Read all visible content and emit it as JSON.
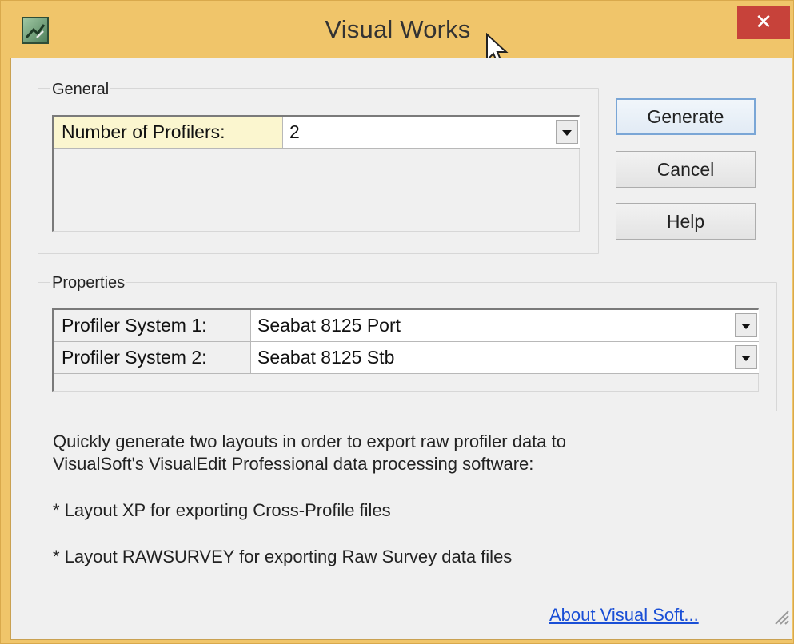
{
  "window": {
    "title": "Visual Works",
    "close_label": "✕"
  },
  "general": {
    "label": "General",
    "rows": [
      {
        "label": "Number of Profilers:",
        "value": "2"
      }
    ]
  },
  "properties": {
    "label": "Properties",
    "rows": [
      {
        "label": "Profiler System 1:",
        "value": "Seabat 8125 Port"
      },
      {
        "label": "Profiler System 2:",
        "value": "Seabat 8125 Stb"
      }
    ]
  },
  "buttons": {
    "generate": "Generate",
    "cancel": "Cancel",
    "help": "Help"
  },
  "description": {
    "line1": "Quickly generate two layouts in order to export raw profiler data to",
    "line2": "VisualSoft's VisualEdit Professional data processing software:",
    "bullet1": "* Layout XP for exporting Cross-Profile files",
    "bullet2": "* Layout RAWSURVEY for exporting Raw Survey data files"
  },
  "link": {
    "about": "About Visual Soft..."
  },
  "icons": {
    "app": "app-icon",
    "close": "close-icon",
    "dropdown": "chevron-down-icon",
    "cursor": "mouse-cursor-icon",
    "grip": "resize-grip-icon"
  },
  "colors": {
    "titlebar": "#f0c56a",
    "close": "#c7423a",
    "link": "#1a4fd6",
    "label_highlight": "#fbf6cf"
  }
}
